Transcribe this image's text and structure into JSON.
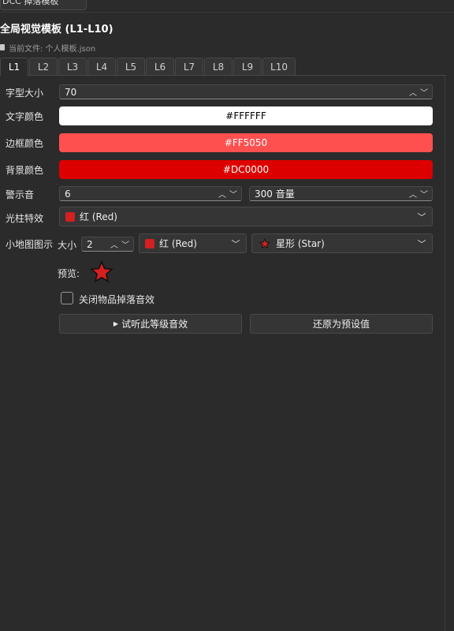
{
  "top_tab": {
    "label": "DCC 掉落模板"
  },
  "panel": {
    "title": "全局视觉模板 (L1-L10)",
    "file_label": "当前文件: 个人模板.json"
  },
  "tabs": [
    "L1",
    "L2",
    "L3",
    "L4",
    "L5",
    "L6",
    "L7",
    "L8",
    "L9",
    "L10"
  ],
  "active_tab": "L1",
  "font_size": {
    "label": "字型大小",
    "value": "70"
  },
  "text_color": {
    "label": "文字颜色",
    "value": "#FFFFFF",
    "hex": "#FFFFFF",
    "text_hex": "#000000"
  },
  "border_color": {
    "label": "边框颜色",
    "value": "#FF5050",
    "hex": "#FF5050",
    "text_hex": "#FFFFFF"
  },
  "bg_color": {
    "label": "背景颜色",
    "value": "#DC0000",
    "hex": "#DC0000",
    "text_hex": "#FFFFFF"
  },
  "alert_sound": {
    "label": "警示音",
    "value": "6",
    "volume": "300 音量"
  },
  "beam_effect": {
    "label": "光柱特效",
    "value": "红 (Red)",
    "swatch_hex": "#D42020"
  },
  "minimap": {
    "label": "小地图图示",
    "size_label": "大小",
    "size_value": "2",
    "color_value": "红 (Red)",
    "shape_value": "星形 (Star)",
    "swatch_hex": "#D42020"
  },
  "preview": {
    "label": "预览:",
    "star_fill": "#D42020"
  },
  "mute_drop": {
    "label": "关闭物品掉落音效",
    "checked": false
  },
  "buttons": {
    "preview_sound": "试听此等级音效",
    "reset": "还原为预设值"
  },
  "icons": {
    "spin_up": "chevron-up-icon",
    "spin_down": "chevron-down-icon",
    "play": "play-icon",
    "star": "star-icon",
    "file": "file-icon"
  }
}
